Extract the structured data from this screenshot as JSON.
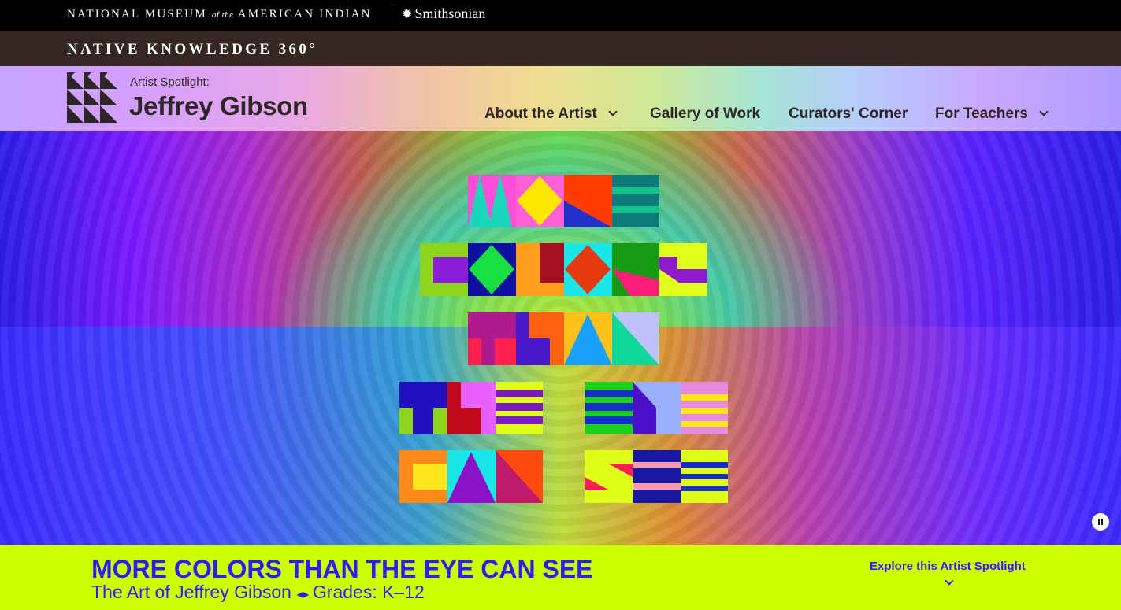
{
  "top_bar": {
    "museum_part1": "NATIONAL MUSEUM",
    "museum_of_the": "of the",
    "museum_part2": "AMERICAN INDIAN",
    "smithsonian": "Smithsonian",
    "sun_icon": "smithsonian-sun-icon"
  },
  "nk_bar": {
    "title": "NATIVE KNOWLEDGE 360°"
  },
  "header": {
    "spotlight_label": "Artist Spotlight:",
    "artist_name": "Jeffrey Gibson",
    "logo_icon": "triangle-grid-logo-icon"
  },
  "nav": {
    "items": [
      {
        "label": "About the Artist",
        "has_dropdown": true
      },
      {
        "label": "Gallery of Work",
        "has_dropdown": false
      },
      {
        "label": "Curators' Corner",
        "has_dropdown": false
      },
      {
        "label": "For Teachers",
        "has_dropdown": true
      }
    ]
  },
  "hero": {
    "artwork_lettering": "MORE COLORS THAN THE EYE CAN SEE",
    "pause_icon": "pause-icon"
  },
  "banner": {
    "title": "MORE COLORS THAN THE EYE CAN SEE",
    "subtitle_part1": "The Art of Jeffrey Gibson",
    "subtitle_part2": "Grades: K–12",
    "explore_label": "Explore this Artist Spotlight"
  },
  "colors": {
    "banner_bg": "#ccff00",
    "banner_text": "#2f1bff",
    "nk_bar_bg": "#33271f",
    "header_text": "#2e2626"
  }
}
